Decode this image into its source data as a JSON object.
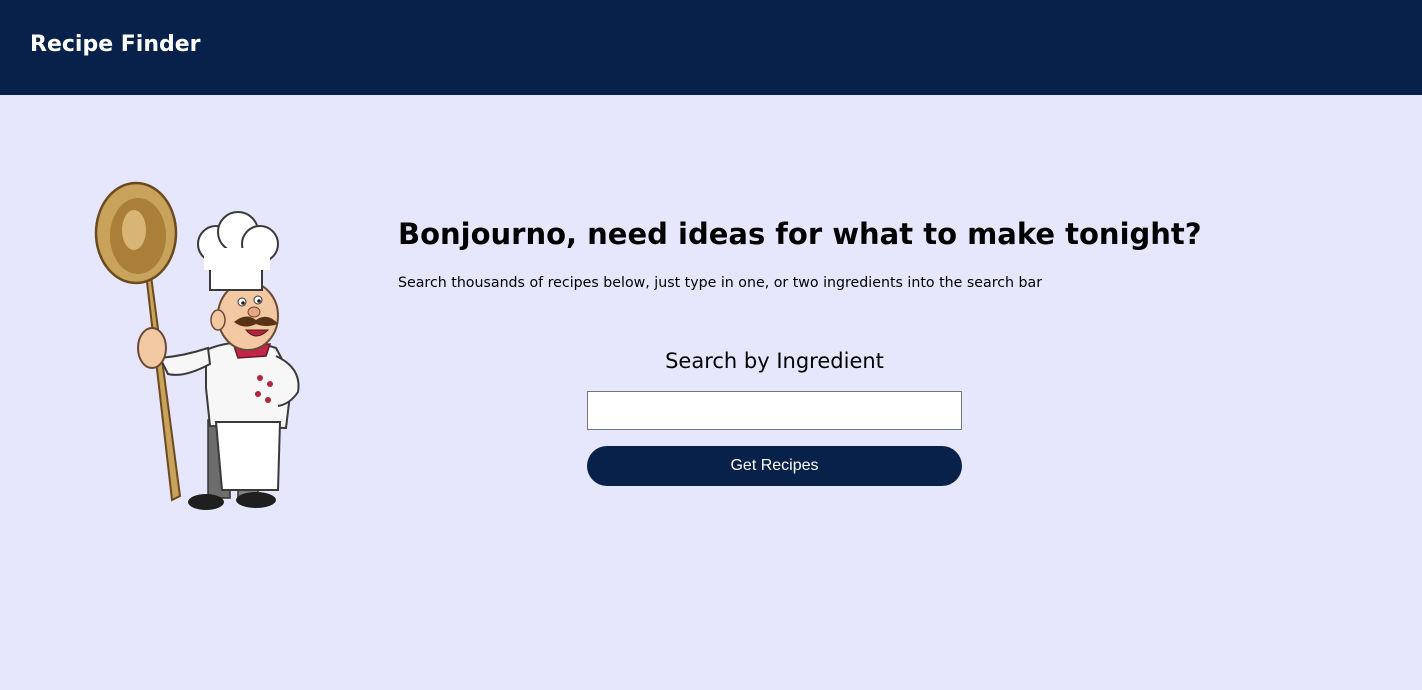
{
  "header": {
    "brand": "Recipe Finder"
  },
  "hero": {
    "headline": "Bonjourno, need ideas for what to make tonight?",
    "subtext": "Search thousands of recipes below, just type in one, or two ingredients into the search bar"
  },
  "search": {
    "label": "Search by Ingredient",
    "value": "",
    "placeholder": "",
    "button_label": "Get Recipes"
  },
  "illustration": {
    "icon": "chef-with-wooden-spoon-illustration"
  },
  "colors": {
    "navbar": "#08214b",
    "background": "#e6e6fd",
    "button": "#08214b",
    "button_text": "#ffffff"
  }
}
